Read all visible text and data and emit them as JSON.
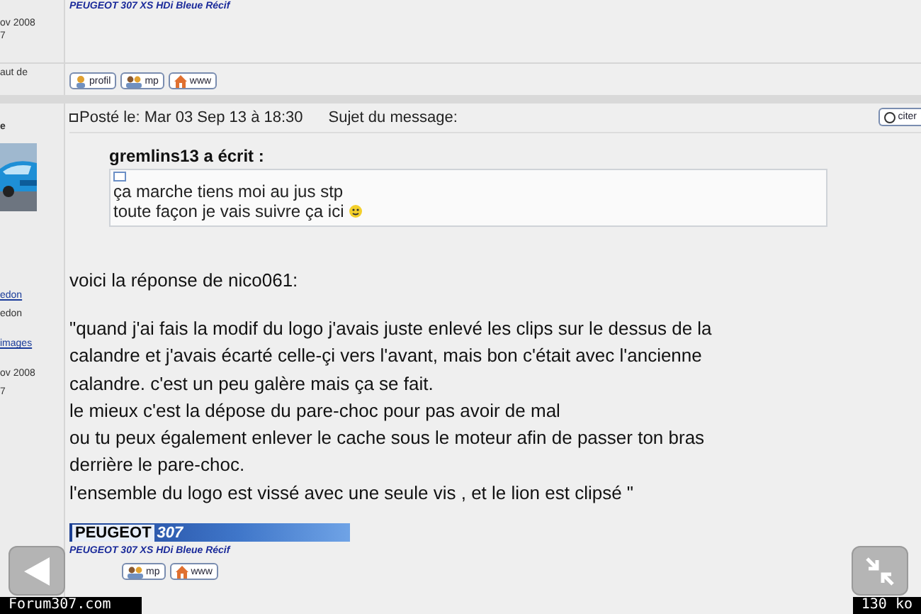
{
  "top_post": {
    "sidebar_lines": [
      {
        "text": "ov 2008",
        "link": false
      },
      {
        "text": "7",
        "link": false
      }
    ],
    "signature": "PEUGEOT 307 XS HDi Bleue Récif",
    "sidebar_link": "aut de",
    "buttons": [
      {
        "kind": "profile",
        "label": "profil"
      },
      {
        "kind": "pm",
        "label": "mp"
      },
      {
        "kind": "web",
        "label": "www"
      }
    ]
  },
  "post": {
    "sidebar_name": "e",
    "sidebar_lines": [
      {
        "text": "edon",
        "link": true
      },
      {
        "text": "edon",
        "link": false
      },
      {
        "text": "images",
        "link": true
      },
      {
        "text": "ov 2008",
        "link": false
      },
      {
        "text": "7",
        "link": false
      }
    ],
    "posted": "Posté le: Mar 03 Sep 13 à 18:30",
    "subject": "Sujet du message:",
    "quote_button": "citer",
    "quote": {
      "author": "gremlins13 a écrit :",
      "lines": [
        "ça marche tiens moi au jus stp",
        "toute façon je vais suivre ça ici"
      ]
    },
    "intro": "voici la réponse de nico061:",
    "body": [
      "\"quand j'ai fais la modif du logo j'avais juste enlevé les clips sur le dessus de la",
      "calandre et j'avais écarté celle-çi vers l'avant, mais bon c'était avec l'ancienne",
      "calandre. c'est un peu galère mais ça se fait.",
      "le mieux c'est la dépose du pare-choc pour pas avoir de mal",
      "ou tu peux également enlever le cache sous le moteur afin de passer ton bras",
      "derrière le pare-choc.",
      "l'ensemble du logo est vissé avec une seule vis , et le lion est clipsé \""
    ],
    "banner": {
      "brand": "PEUGEOT",
      "model": "307"
    },
    "signature": "PEUGEOT 307 XS HDi Bleue Récif",
    "buttons": [
      {
        "kind": "pm",
        "label": "mp"
      },
      {
        "kind": "web",
        "label": "www"
      }
    ]
  },
  "status_bar": {
    "site": "Forum307.com",
    "size": "130 ko"
  }
}
